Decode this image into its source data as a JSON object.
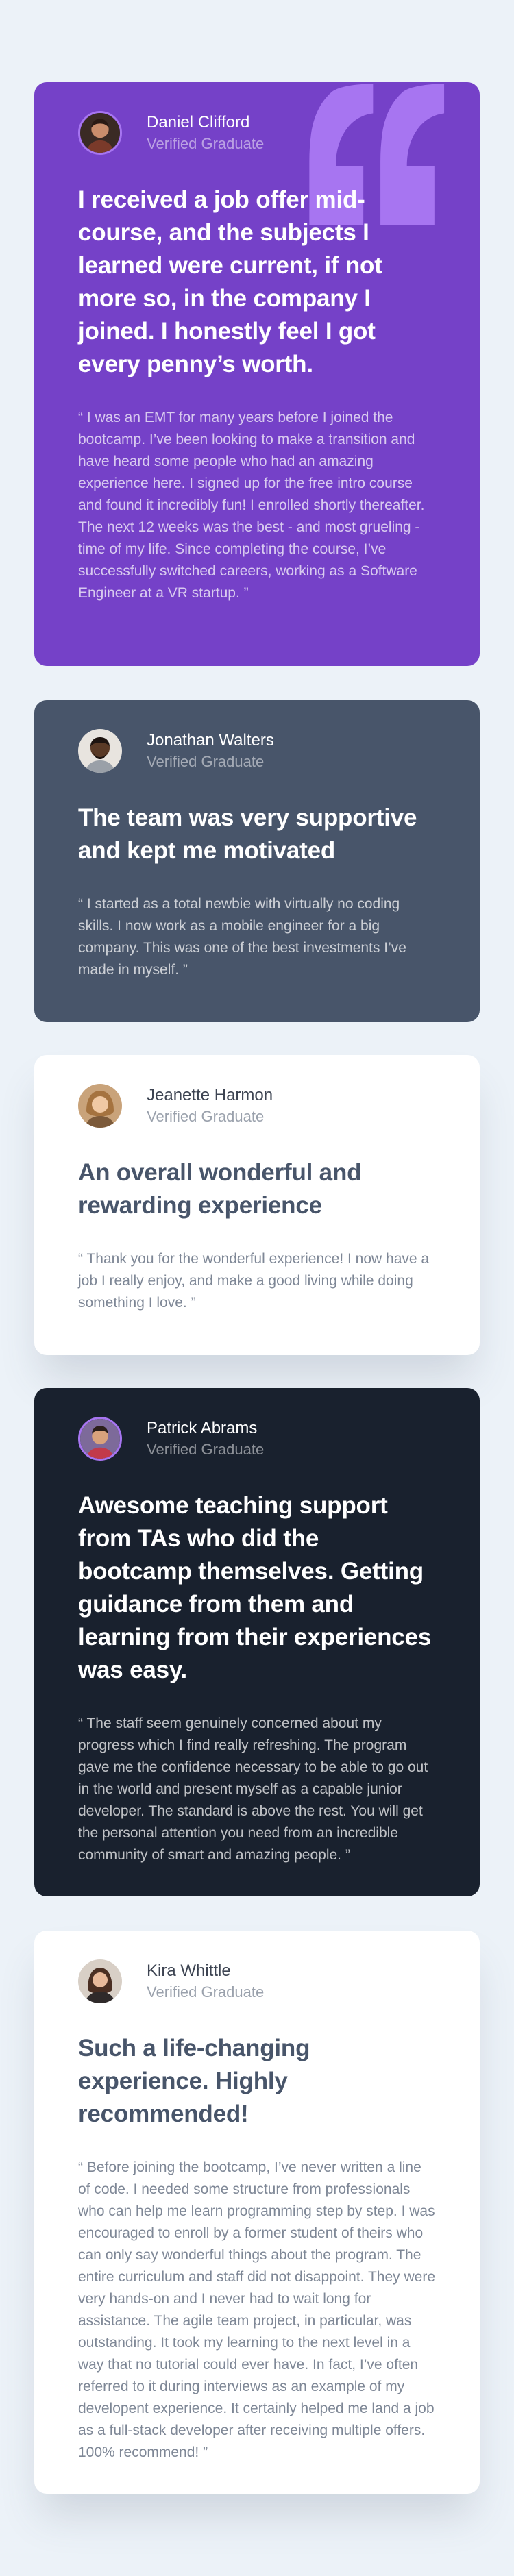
{
  "colors": {
    "page_background": "#ECF2F8",
    "moderate_violet": "#7541C8",
    "grayish_blue": "#48556A",
    "white": "#FFFFFF",
    "very_dark_blackish_blue": "#19212E",
    "light_violet_quote": "#A775F1"
  },
  "testimonials": [
    {
      "name": "Daniel Clifford",
      "role": "Verified Graduate",
      "headline": "I received a job offer mid-course, and the subjects I learned were current, if not more so, in the company I joined. I honestly feel I got every penny’s worth.",
      "body": "“ I was an EMT for many years before I joined the bootcamp. I’ve been looking to make a transition and have heard some people who had an amazing experience here. I signed up for the free intro course and found it incredibly fun! I enrolled shortly thereafter. The next 12 weeks was the best - and most grueling - time of my life. Since completing the course, I’ve successfully switched careers, working as a Software Engineer at a VR startup. ”",
      "theme": "purple",
      "avatar_icon": "avatar-photo-icon"
    },
    {
      "name": "Jonathan Walters",
      "role": "Verified Graduate",
      "headline": "The team was very supportive and kept me motivated",
      "body": "“ I started as a total newbie with virtually no coding skills. I now work as a mobile engineer for a big company. This was one of the best investments I’ve made in myself. ”",
      "theme": "grey",
      "avatar_icon": "avatar-photo-icon"
    },
    {
      "name": "Jeanette Harmon",
      "role": "Verified Graduate",
      "headline": "An overall wonderful and rewarding experience",
      "body": "“ Thank you for the wonderful experience! I now have a job I really enjoy, and make a good living while doing something I love. ”",
      "theme": "white",
      "avatar_icon": "avatar-photo-icon"
    },
    {
      "name": "Patrick Abrams",
      "role": "Verified Graduate",
      "headline": "Awesome teaching support from TAs who did the bootcamp themselves. Getting guidance from them and learning from their experiences was easy.",
      "body": "“ The staff seem genuinely concerned about my progress which I find really refreshing. The program gave me the confidence necessary to be able to go out in the world and present myself as a capable junior developer. The standard is above the rest. You will get the personal attention you need from an incredible community of smart and amazing people. ”",
      "theme": "dark",
      "avatar_icon": "avatar-photo-icon"
    },
    {
      "name": "Kira Whittle",
      "role": "Verified Graduate",
      "headline": "Such a life-changing experience. Highly recommended!",
      "body": "“ Before joining the bootcamp, I’ve never written a line of code. I needed some structure from professionals who can help me learn programming step by step. I was encouraged to enroll by a former student of theirs who can only say wonderful things about the program. The entire curriculum and staff did not disappoint. They were very hands-on and I never had to wait long for assistance. The agile team project, in particular, was outstanding. It took my learning to the next level in a way that no tutorial could ever have. In fact, I’ve often referred to it during interviews as an example of my developent experience. It certainly helped me land a job as a full-stack developer after receiving multiple offers. 100% recommend! ”",
      "theme": "white",
      "avatar_icon": "avatar-photo-icon"
    }
  ]
}
